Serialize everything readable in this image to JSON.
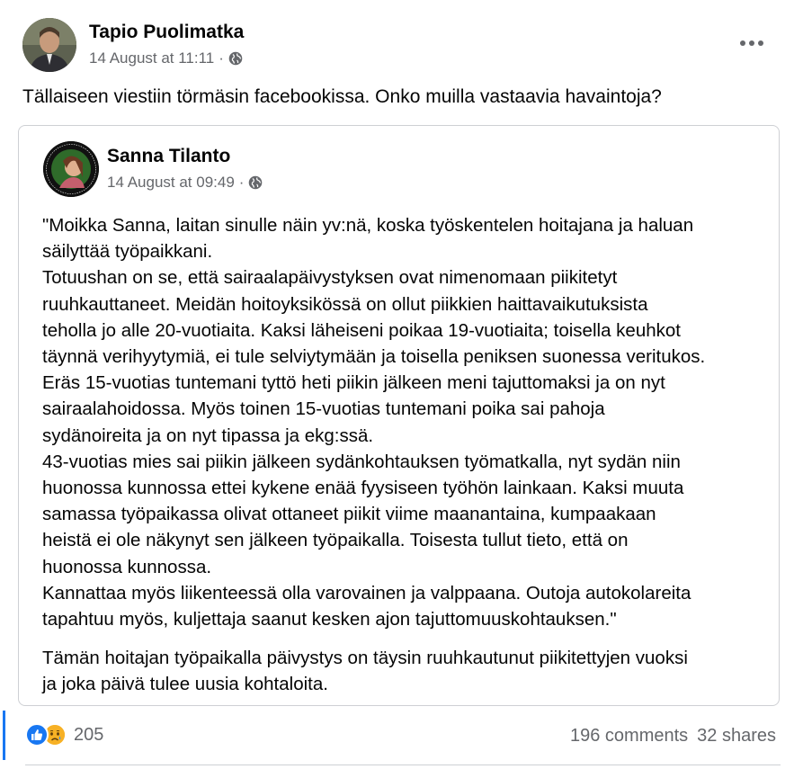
{
  "post": {
    "author": "Tapio Puolimatka",
    "timestamp": "14 August at 11:11",
    "separator": "·",
    "privacy_icon": "globe-icon",
    "text": "Tällaiseen viestiin törmäsin facebookissa. Onko muilla vastaavia havaintoja?"
  },
  "shared_post": {
    "author": "Sanna Tilanto",
    "timestamp": "14 August at 09:49",
    "separator": "·",
    "privacy_icon": "globe-icon",
    "body_lines": [
      "\"Moikka Sanna, laitan sinulle näin yv:nä, koska työskentelen hoitajana ja haluan",
      "säilyttää työpaikkani.",
      "Totuushan on se, että sairaalapäivystyksen ovat nimenomaan piikitetyt",
      "ruuhkauttaneet. Meidän hoitoyksikössä on ollut piikkien haittavaikutuksista",
      "teholla jo alle 20-vuotiaita. Kaksi läheiseni poikaa 19-vuotiaita; toisella keuhkot",
      "täynnä verihyytymiä, ei tule selviytymään ja toisella peniksen suonessa veritukos.",
      "Eräs 15-vuotias tuntemani tyttö heti piikin jälkeen meni tajuttomaksi ja on nyt",
      "sairaalahoidossa. Myös toinen 15-vuotias tuntemani poika sai pahoja",
      "sydänoireita ja on nyt tipassa ja ekg:ssä.",
      "43-vuotias mies sai piikin jälkeen sydänkohtauksen työmatkalla, nyt sydän niin",
      "huonossa kunnossa ettei kykene enää fyysiseen työhön lainkaan. Kaksi muuta",
      "samassa työpaikassa olivat ottaneet piikit viime maanantaina, kumpaakaan",
      "heistä ei ole näkynyt sen jälkeen työpaikalla. Toisesta tullut tieto, että on",
      "huonossa kunnossa.",
      "Kannattaa myös liikenteessä olla varovainen ja valppaana. Outoja autokolareita",
      "tapahtuu myös, kuljettaja saanut kesken ajon tajuttomuuskohtauksen.\""
    ],
    "closing_lines": [
      "Tämän hoitajan työpaikalla päivystys on täysin ruuhkautunut piikitettyjen vuoksi",
      "ja joka päivä tulee uusia kohtaloita."
    ]
  },
  "footer": {
    "reaction_icons": [
      "like-icon",
      "sad-icon"
    ],
    "reaction_count": "205",
    "comments": "196 comments",
    "shares": "32 shares"
  },
  "colors": {
    "text_primary": "#050505",
    "text_secondary": "#65676b",
    "accent_blue": "#1877f2",
    "sad_yellow": "#f7b125",
    "border": "#ced0d4"
  }
}
